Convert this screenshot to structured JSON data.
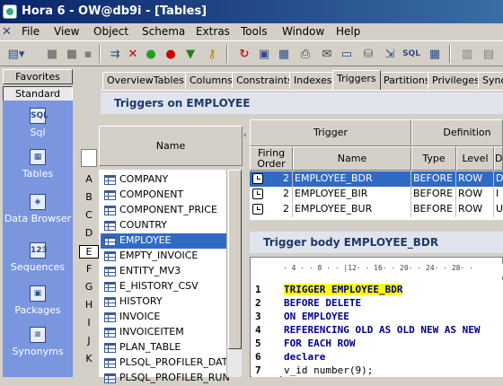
{
  "window": {
    "title": "Hora 6 - OW@db9i - [Tables]"
  },
  "menu": [
    "File",
    "View",
    "Object",
    "Schema",
    "Extras",
    "Tools",
    "Window",
    "Help"
  ],
  "toolbar_icons": [
    "add-menu-icon",
    "separator",
    "run-icon",
    "delete-icon",
    "green-dot-icon",
    "red-dot-icon",
    "filter-icon",
    "key-icon",
    "separator",
    "refresh-icon",
    "doc-icon",
    "grid-icon",
    "print-icon",
    "mail-icon",
    "window-icon",
    "db-icon",
    "export-icon",
    "sql-icon",
    "table-icon"
  ],
  "sidebar": {
    "favorites": "Favorites",
    "standard": "Standard",
    "items": [
      {
        "label": "Sql",
        "icon": "sql-icon",
        "glyph": "SQL"
      },
      {
        "label": "Tables",
        "icon": "table-icon",
        "glyph": "▦"
      },
      {
        "label": "Data Browser",
        "icon": "data-browser-icon",
        "glyph": "◈"
      },
      {
        "label": "Sequences",
        "icon": "sequence-icon",
        "glyph": "123"
      },
      {
        "label": "Packages",
        "icon": "package-icon",
        "glyph": "▣"
      },
      {
        "label": "Synonyms",
        "icon": "synonym-icon",
        "glyph": "≡"
      }
    ]
  },
  "tabs": [
    "OverviewTables",
    "Columns",
    "Constraints",
    "Indexes",
    "Triggers",
    "Partitions",
    "Privileges",
    "Syno"
  ],
  "active_tab": "Triggers",
  "content": {
    "title": "Triggers on EMPLOYEE"
  },
  "table_list": {
    "header": "Name",
    "letters": [
      "A",
      "B",
      "C",
      "D",
      "E",
      "F",
      "G",
      "H",
      "I",
      "J",
      "K"
    ],
    "selected_letter": "E",
    "items": [
      "COMPANY",
      "COMPONENT",
      "COMPONENT_PRICE",
      "COUNTRY",
      "EMPLOYEE",
      "EMPTY_INVOICE",
      "ENTITY_MV3",
      "E_HISTORY_CSV",
      "HISTORY",
      "INVOICE",
      "INVOICEITEM",
      "PLAN_TABLE",
      "PLSQL_PROFILER_DAT",
      "PLSQL_PROFILER_RUN"
    ],
    "selected_item": "EMPLOYEE"
  },
  "triggers": {
    "header_group_trigger": "Trigger",
    "header_group_definition": "Definition",
    "columns": [
      "Firing Order",
      "Name",
      "Type",
      "Level",
      "D"
    ],
    "rows": [
      {
        "order": "2",
        "name": "EMPLOYEE_BDR",
        "type": "BEFORE",
        "level": "ROW",
        "d": "D"
      },
      {
        "order": "2",
        "name": "EMPLOYEE_BIR",
        "type": "BEFORE",
        "level": "ROW",
        "d": "I"
      },
      {
        "order": "2",
        "name": "EMPLOYEE_BUR",
        "type": "BEFORE",
        "level": "ROW",
        "d": "U"
      }
    ]
  },
  "trigger_body": {
    "title": "Trigger body EMPLOYEE_BDR",
    "ruler": "· 4 · · 8 · · |12· · 16· · 20· · 24· · 28· ·",
    "lines": [
      {
        "n": "1",
        "text": "TRIGGER EMPLOYEE_BDR"
      },
      {
        "n": "2",
        "text": "BEFORE DELETE"
      },
      {
        "n": "3",
        "text": "ON EMPLOYEE"
      },
      {
        "n": "4",
        "text": "REFERENCING OLD AS OLD NEW AS NEW"
      },
      {
        "n": "5",
        "text": "FOR EACH ROW"
      },
      {
        "n": "6",
        "text": "declare"
      },
      {
        "n": "7",
        "text": "  v_id number(9);"
      }
    ]
  }
}
